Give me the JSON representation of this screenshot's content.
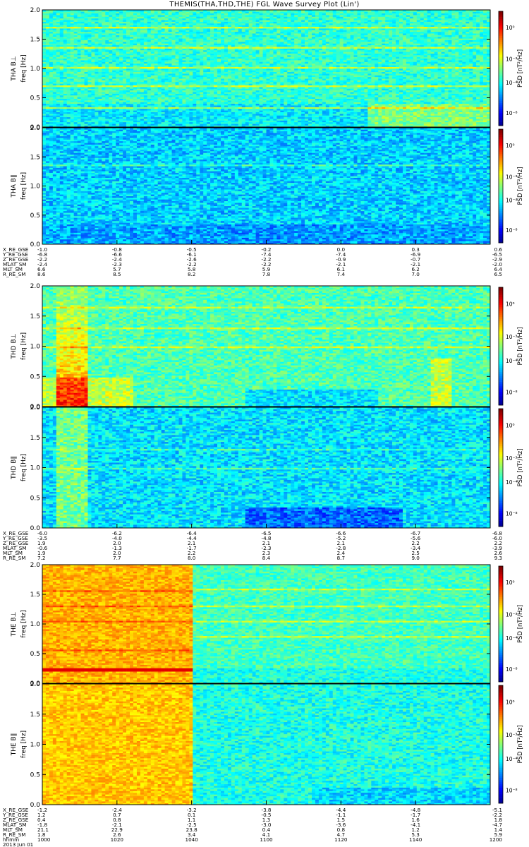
{
  "title": "THEMIS(THA,THD,THE) FGL Wave Survey Plot (Lin')",
  "chart_data": {
    "type": "heatmap",
    "freq_axis": {
      "label": "freq [Hz]",
      "range": [
        0.0,
        2.0
      ],
      "ticks": [
        "0.0",
        "0.5",
        "1.0",
        "1.5",
        "2.0"
      ]
    },
    "colorbar": {
      "label": "PSD [nT²/Hz]",
      "scale": "log",
      "ticks": [
        "10⁰",
        "10⁻³",
        "10⁻⁴",
        "10⁻⁸"
      ]
    },
    "panels": [
      {
        "probe": "THA",
        "component": "B⊥",
        "ylabel": "THA B⊥",
        "intensity": "low",
        "features": [
          "harmonic bands at ~0.35, 0.7, 1.0, 1.35, 1.7 Hz",
          "enhanced below 0.4 Hz after 1120"
        ]
      },
      {
        "probe": "THA",
        "component": "B∥",
        "ylabel": "THA B∥",
        "intensity": "low",
        "features": [
          "weak harmonic bands",
          "minimum near 1040-1120 below 0.3 Hz"
        ]
      },
      {
        "probe": "THD",
        "component": "B⊥",
        "ylabel": "THD B⊥",
        "intensity": "medium",
        "features": [
          "broadband enhancement 1003-1010",
          "harmonic bands at ~1.0, 1.3 Hz"
        ]
      },
      {
        "probe": "THD",
        "component": "B∥",
        "ylabel": "THD B∥",
        "intensity": "low",
        "features": [
          "enhancement near 1005",
          "minimum near 1100-1140 below 0.3 Hz"
        ]
      },
      {
        "probe": "THE",
        "component": "B⊥",
        "ylabel": "THE B⊥",
        "intensity": "high",
        "features": [
          "strong broadband before ~1041",
          "red band at ~0.22 Hz",
          "harmonic lines"
        ]
      },
      {
        "probe": "THE",
        "component": "B∥",
        "ylabel": "THE B∥",
        "intensity": "high",
        "features": [
          "strong broadband before ~1041"
        ]
      }
    ],
    "ephemeris_blocks": [
      {
        "labels": [
          "X_RE_GSE",
          "Y_RE_GSE",
          "Z_RE_GSE",
          "MLAT_SM",
          "MLT_SM",
          "R_RE_SM"
        ],
        "columns": [
          [
            "-1.0",
            "-6.8",
            "-2.2",
            "-2.4",
            "6.6",
            "8.6"
          ],
          [
            "-0.8",
            "-6.6",
            "-2.4",
            "-2.3",
            "5.7",
            "8.5"
          ],
          [
            "-0.5",
            "-6.1",
            "-2.6",
            "-2.2",
            "5.8",
            "8.2"
          ],
          [
            "-0.2",
            "-7.4",
            "-2.2",
            "-2.2",
            "5.9",
            "7.8"
          ],
          [
            "0.0",
            "-7.4",
            "-0.9",
            "-2.1",
            "6.1",
            "7.4"
          ],
          [
            "0.3",
            "-6.9",
            "-0.7",
            "-2.1",
            "6.2",
            "7.0"
          ],
          [
            "0.6",
            "-6.5",
            "-2.9",
            "-2.0",
            "6.4",
            "6.5"
          ]
        ]
      },
      {
        "labels": [
          "X_RE_GSE",
          "Y_RE_GSE",
          "Z_RE_GSE",
          "MLAT_SM",
          "MLT_SM",
          "R_RE_SM"
        ],
        "columns": [
          [
            "-6.0",
            "-3.5",
            "1.9",
            "-0.6",
            "1.9",
            "7.2"
          ],
          [
            "-6.2",
            "-4.0",
            "2.0",
            "-1.3",
            "2.0",
            "7.7"
          ],
          [
            "-6.4",
            "-4.4",
            "2.1",
            "-1.7",
            "2.2",
            "8.0"
          ],
          [
            "-6.5",
            "-4.8",
            "2.1",
            "-2.3",
            "2.3",
            "8.4"
          ],
          [
            "-6.6",
            "-5.2",
            "2.1",
            "-2.8",
            "2.4",
            "8.7"
          ],
          [
            "-6.7",
            "-5.6",
            "2.2",
            "-3.4",
            "2.5",
            "9.0"
          ],
          [
            "-6.8",
            "-6.0",
            "2.2",
            "-3.9",
            "2.6",
            "9.3"
          ]
        ]
      },
      {
        "labels": [
          "X_RE_GSE",
          "Y_RE_GSE",
          "Z_RE_GSE",
          "MLAT_SM",
          "MLT_SM",
          "R_RE_SM",
          "hhmm",
          "2013 Jun 01"
        ],
        "columns": [
          [
            "-1.2",
            "1.2",
            "0.4",
            "-1.8",
            "21.1",
            "1.8",
            "1000"
          ],
          [
            "-2.4",
            "0.7",
            "0.8",
            "-2.1",
            "22.9",
            "2.6",
            "1020"
          ],
          [
            "-3.2",
            "0.1",
            "1.1",
            "-2.5",
            "23.8",
            "3.4",
            "1040"
          ],
          [
            "-3.8",
            "-0.5",
            "1.3",
            "-3.0",
            "0.4",
            "4.1",
            "1100"
          ],
          [
            "-4.4",
            "-1.1",
            "1.5",
            "-3.6",
            "0.8",
            "4.7",
            "1120"
          ],
          [
            "-4.8",
            "-1.7",
            "1.6",
            "-4.1",
            "1.2",
            "5.3",
            "1140"
          ],
          [
            "-5.1",
            "-2.2",
            "1.8",
            "-4.7",
            "1.4",
            "5.9",
            "1200"
          ]
        ]
      }
    ]
  }
}
